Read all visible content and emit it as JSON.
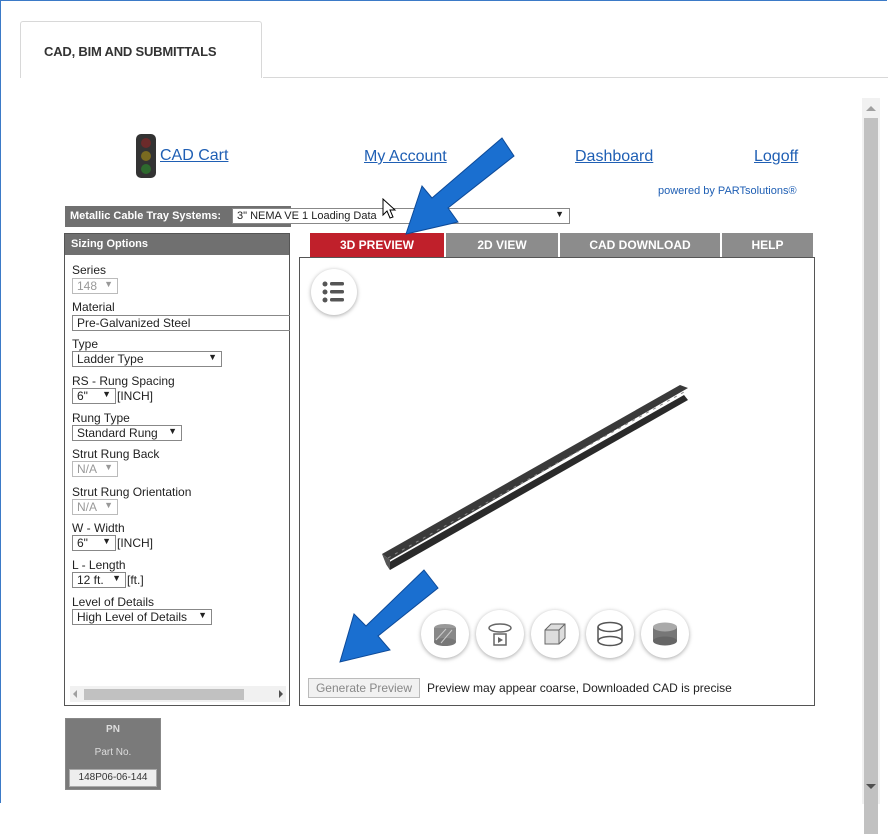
{
  "tab": {
    "label": "CAD, BIM AND SUBMITTALS"
  },
  "nav": {
    "cad_cart": "CAD Cart",
    "my_account": "My Account",
    "dashboard": "Dashboard",
    "logoff": "Logoff",
    "powered_by": "powered by PARTsolutions®"
  },
  "system": {
    "label": "Metallic Cable Tray Systems:",
    "selected": "3\" NEMA VE 1 Loading Data"
  },
  "sizing": {
    "title": "Sizing Options",
    "series": {
      "label": "Series",
      "value": "148"
    },
    "material": {
      "label": "Material",
      "value": "Pre-Galvanized Steel"
    },
    "type": {
      "label": "Type",
      "value": "Ladder Type"
    },
    "rung_spacing": {
      "label": "RS - Rung Spacing",
      "value": "6\"",
      "unit": "[INCH]"
    },
    "rung_type": {
      "label": "Rung Type",
      "value": "Standard Rung"
    },
    "strut_rung_back": {
      "label": "Strut Rung Back",
      "value": "N/A"
    },
    "strut_rung_orientation": {
      "label": "Strut Rung Orientation",
      "value": "N/A"
    },
    "width": {
      "label": "W - Width",
      "value": "6\"",
      "unit": "[INCH]"
    },
    "length": {
      "label": "L - Length",
      "value": "12 ft.",
      "unit": "[ft.]"
    },
    "level_of_details": {
      "label": "Level of Details",
      "value": "High Level of Details"
    }
  },
  "viewer_tabs": [
    "3D PREVIEW",
    "2D VIEW",
    "CAD DOWNLOAD",
    "HELP"
  ],
  "viewer": {
    "generate_button": "Generate Preview",
    "note": "Preview may appear coarse, Downloaded CAD is precise"
  },
  "part_number": {
    "header": "PN",
    "subheader": "Part No.",
    "value": "148P06-06-144"
  },
  "colors": {
    "active_tab": "#c0202b",
    "inactive_tab": "#8c8c8c",
    "link": "#1f5fb4",
    "arrow": "#1a6fd0"
  }
}
